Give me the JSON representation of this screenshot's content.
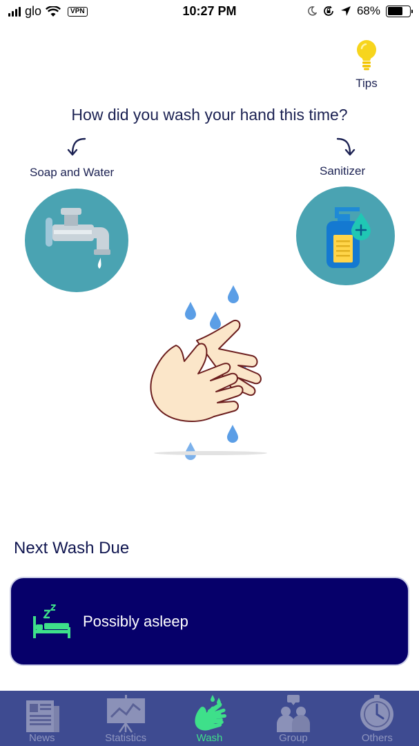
{
  "status_bar": {
    "carrier": "glo",
    "vpn": "VPN",
    "time": "10:27 PM",
    "battery": "68%",
    "battery_level": 0.68
  },
  "tips": {
    "label": "Tips",
    "icon": "lightbulb-icon",
    "color": "#f7d51d"
  },
  "question": "How did you wash your hand this time?",
  "options": {
    "soap": {
      "label": "Soap and Water",
      "icon": "faucet-icon"
    },
    "sanitizer": {
      "label": "Sanitizer",
      "icon": "sanitizer-bottle-icon"
    }
  },
  "next_wash": {
    "title": "Next Wash Due",
    "status": "Possibly asleep",
    "icon": "sleeping-bed-icon"
  },
  "tabs": [
    {
      "label": "News",
      "icon": "newspaper-icon",
      "active": false
    },
    {
      "label": "Statistics",
      "icon": "chart-board-icon",
      "active": false
    },
    {
      "label": "Wash",
      "icon": "washing-hands-icon",
      "active": true
    },
    {
      "label": "Group",
      "icon": "group-icon",
      "active": false
    },
    {
      "label": "Others",
      "icon": "clock-icon",
      "active": false
    }
  ],
  "colors": {
    "accent": "#3ee08a",
    "card": "#06006a",
    "tab_bar": "#3e4b91",
    "circle": "#4aa3b2",
    "text": "#1b2152",
    "droplet": "#5b9ee6"
  }
}
